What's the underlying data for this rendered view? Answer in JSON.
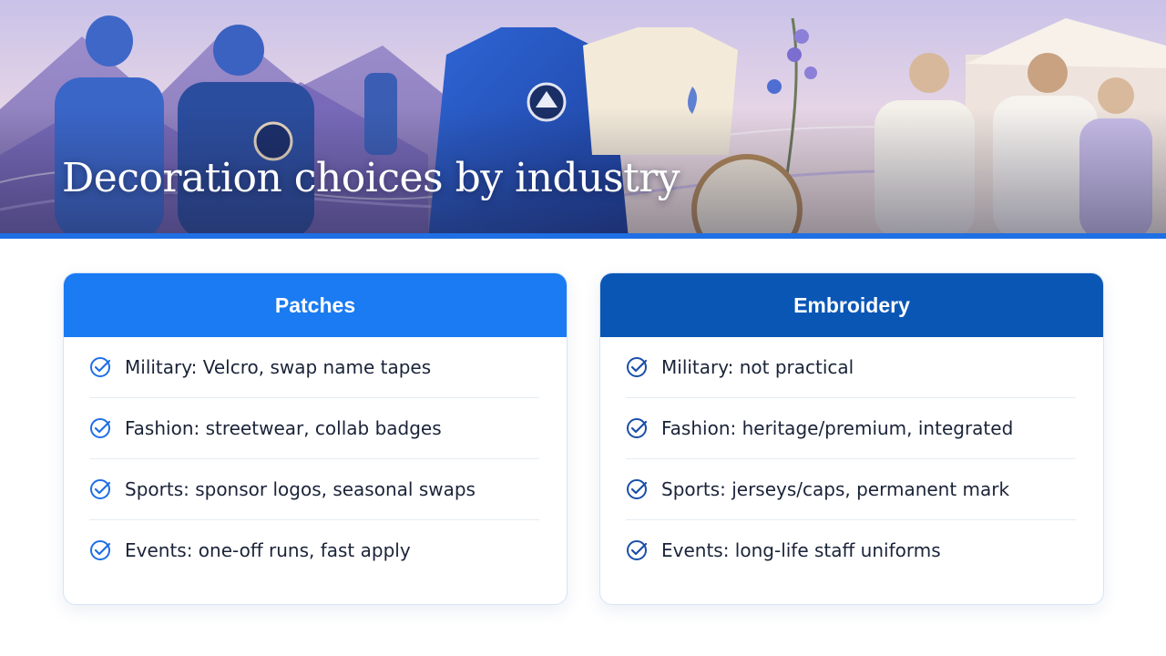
{
  "hero": {
    "title": "Decoration choices by industry"
  },
  "colors": {
    "accent_bar": "#1f6fe5",
    "patches_header": "#1a7bf2",
    "embroidery_header": "#0a56b5",
    "check_icon": "#1f6fe5"
  },
  "patches": {
    "title": "Patches",
    "items": [
      "Military: Velcro, swap name tapes",
      "Fashion: streetwear, collab badges",
      "Sports: sponsor logos, seasonal swaps",
      "Events: one-off runs, fast apply"
    ]
  },
  "embroidery": {
    "title": "Embroidery",
    "items": [
      "Military: not practical",
      "Fashion: heritage/premium, integrated",
      "Sports: jerseys/caps, permanent mark",
      "Events: long-life staff uniforms"
    ]
  },
  "icons": {
    "check": "check-circle-icon"
  }
}
